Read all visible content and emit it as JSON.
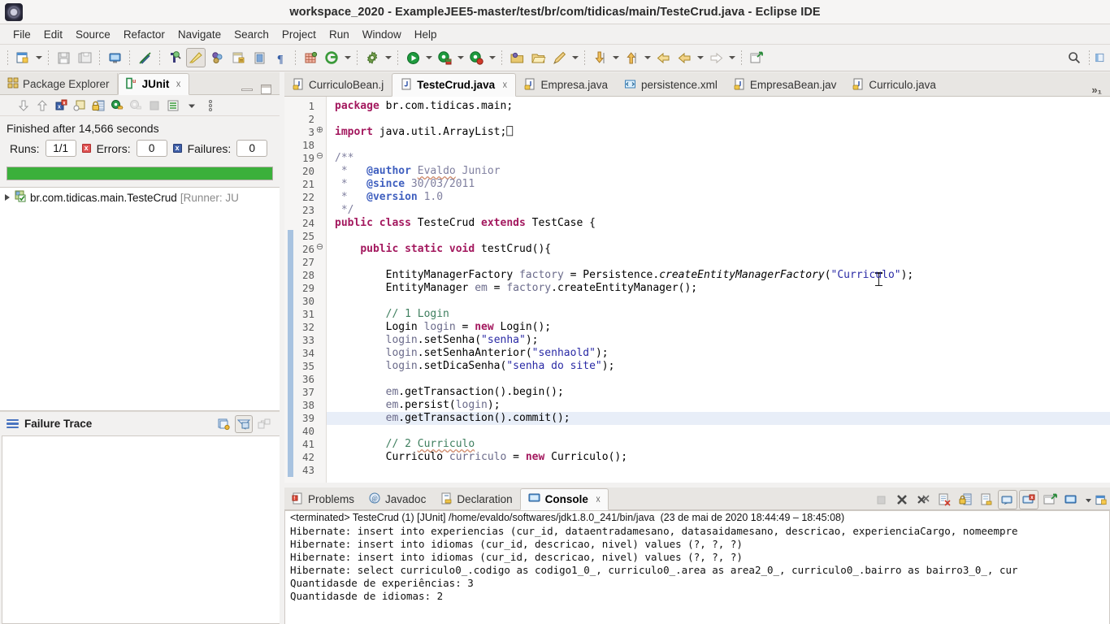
{
  "window": {
    "title": "workspace_2020 - ExampleJEE5-master/test/br/com/tidicas/main/TesteCrud.java - Eclipse IDE",
    "app_icon": "eclipse-icon"
  },
  "menubar": {
    "items": [
      "File",
      "Edit",
      "Source",
      "Refactor",
      "Navigate",
      "Search",
      "Project",
      "Run",
      "Window",
      "Help"
    ]
  },
  "toolbar": {
    "buttons": [
      {
        "name": "new-wizard",
        "icon": "new-file-icon",
        "dropdown": true
      },
      {
        "name": "save",
        "icon": "save-icon",
        "dropdown": false
      },
      {
        "name": "save-all",
        "icon": "save-all-icon",
        "dropdown": false
      },
      {
        "name": "new-java-class",
        "icon": "monitor-icon",
        "dropdown": false
      },
      {
        "name": "toggle-mark-occurrences",
        "icon": "pen-strike-icon",
        "dropdown": false
      },
      {
        "name": "open-type",
        "icon": "search-type-icon",
        "dropdown": false
      },
      {
        "name": "quick-access",
        "icon": "highlight-icon",
        "dropdown": false
      },
      {
        "name": "link-with-editor",
        "icon": "spheres-icon",
        "dropdown": false
      },
      {
        "name": "new-package",
        "icon": "package-icon",
        "dropdown": false
      },
      {
        "name": "open-task",
        "icon": "task-icon",
        "dropdown": false
      },
      {
        "name": "pilcrow",
        "icon": "pilcrow-icon",
        "dropdown": false
      },
      {
        "name": "new-deployment",
        "icon": "grid-icon",
        "dropdown": false
      },
      {
        "name": "git-repository",
        "icon": "git-icon",
        "dropdown": true
      },
      {
        "name": "external-tools",
        "icon": "gear-icon",
        "dropdown": true
      },
      {
        "name": "run",
        "icon": "run-icon",
        "dropdown": true
      },
      {
        "name": "debug",
        "icon": "debug-green-icon",
        "dropdown": true
      },
      {
        "name": "coverage",
        "icon": "coverage-red-icon",
        "dropdown": true
      },
      {
        "name": "open-resource",
        "icon": "folder-open-blue-icon",
        "dropdown": false
      },
      {
        "name": "open-folder",
        "icon": "folder-open-icon",
        "dropdown": false
      },
      {
        "name": "annotation",
        "icon": "pencil-icon",
        "dropdown": true
      },
      {
        "name": "next-annotation",
        "icon": "arrow-down-marker-icon",
        "dropdown": true
      },
      {
        "name": "previous-annotation",
        "icon": "arrow-up-marker-icon",
        "dropdown": true
      },
      {
        "name": "back",
        "icon": "back-arrow-icon",
        "dropdown": false
      },
      {
        "name": "forward-history",
        "icon": "left-arrow-icon",
        "dropdown": true
      },
      {
        "name": "forward",
        "icon": "right-arrow-icon",
        "dropdown": true
      },
      {
        "name": "open-perspective",
        "icon": "open-perspective-icon",
        "dropdown": false
      }
    ],
    "right_buttons": [
      {
        "name": "quick-access-search",
        "icon": "search-icon"
      },
      {
        "name": "perspective-switch",
        "icon": "perspective-icon"
      }
    ]
  },
  "left_panel": {
    "tabs": [
      {
        "label": "Package Explorer",
        "icon": "package-explorer-icon",
        "active": false,
        "closable": false
      },
      {
        "label": "JUnit",
        "icon": "junit-icon",
        "active": true,
        "closable": true
      }
    ],
    "view_buttons": [
      {
        "name": "minimize-view-button",
        "icon": "minimize-icon"
      },
      {
        "name": "maximize-view-button",
        "icon": "maximize-icon"
      }
    ],
    "junit_toolbar": [
      {
        "name": "next-failure-button",
        "icon": "arrow-down-icon"
      },
      {
        "name": "previous-failure-button",
        "icon": "arrow-up-icon"
      },
      {
        "name": "show-failures-only-button",
        "icon": "failures-filter-icon"
      },
      {
        "name": "show-test-hierarchy-button",
        "icon": "hierarchy-icon"
      },
      {
        "name": "lock-scroll-button",
        "icon": "lock-icon"
      },
      {
        "name": "rerun-test-button",
        "icon": "rerun-icon"
      },
      {
        "name": "rerun-failed-button",
        "icon": "rerun-failed-icon"
      },
      {
        "name": "stop-button",
        "icon": "stop-icon"
      },
      {
        "name": "test-runner-list-button",
        "icon": "list-icon"
      },
      {
        "name": "test-runner-dropdown",
        "icon": "chevron-down-icon"
      },
      {
        "name": "view-menu-button",
        "icon": "view-menu-icon"
      }
    ],
    "status_text": "Finished after 14,566 seconds",
    "counters": {
      "runs_label": "Runs:",
      "runs_value": "1/1",
      "errors_label": "Errors:",
      "errors_value": "0",
      "failures_label": "Failures:",
      "failures_value": "0"
    },
    "progress": {
      "percent": 100,
      "color": "#3bb03b"
    },
    "tree": [
      {
        "icon": "test-class-passed-icon",
        "label": "br.com.tidicas.main.TesteCrud",
        "suffix": " [Runner: JU",
        "expanded": false
      }
    ],
    "failure_trace": {
      "title": "Failure Trace",
      "icon": "hamburger-icon",
      "buttons": [
        {
          "name": "copy-trace-button",
          "icon": "copy-icon"
        },
        {
          "name": "filter-stack-trace-button",
          "icon": "filter-icon"
        },
        {
          "name": "compare-result-button",
          "icon": "compare-icon"
        }
      ],
      "content": ""
    }
  },
  "editor": {
    "tabs": [
      {
        "label": "CurriculoBean.j",
        "icon": "java-file-icon",
        "active": false,
        "closable": false
      },
      {
        "label": "TesteCrud.java",
        "icon": "java-file-icon",
        "active": true,
        "closable": true
      },
      {
        "label": "Empresa.java",
        "icon": "java-file-icon",
        "active": false,
        "closable": false
      },
      {
        "label": "persistence.xml",
        "icon": "xml-file-icon",
        "active": false,
        "closable": false
      },
      {
        "label": "EmpresaBean.jav",
        "icon": "java-file-icon",
        "active": false,
        "closable": false
      },
      {
        "label": "Curriculo.java",
        "icon": "java-file-icon",
        "active": false,
        "closable": false
      }
    ],
    "overflow_indicator": "»₁",
    "highlighted_line": 39,
    "lines": [
      {
        "num": "1",
        "fold": "",
        "tokens": [
          {
            "t": "package ",
            "c": "k"
          },
          {
            "t": "br.com.tidicas.main;",
            "c": "plain"
          }
        ]
      },
      {
        "num": "2",
        "fold": "",
        "tokens": []
      },
      {
        "num": "3",
        "fold": "+",
        "tokens": [
          {
            "t": "import ",
            "c": "k"
          },
          {
            "t": "java.util.ArrayList;",
            "c": "plain"
          },
          {
            "t": "⎕",
            "c": "fold-box"
          }
        ]
      },
      {
        "num": "18",
        "fold": "",
        "tokens": []
      },
      {
        "num": "19",
        "fold": "-",
        "tokens": [
          {
            "t": "/**",
            "c": "cm"
          }
        ]
      },
      {
        "num": "20",
        "fold": "",
        "tokens": [
          {
            "t": " * ",
            "c": "cm"
          },
          {
            "t": "  @author",
            "c": "jd"
          },
          {
            "t": " ",
            "c": "cm"
          },
          {
            "t": "Evaldo",
            "c": "cm-spell"
          },
          {
            "t": " Junior",
            "c": "cm"
          }
        ]
      },
      {
        "num": "21",
        "fold": "",
        "tokens": [
          {
            "t": " * ",
            "c": "cm"
          },
          {
            "t": "  @since",
            "c": "jd"
          },
          {
            "t": " 30/03/2011",
            "c": "cm"
          }
        ]
      },
      {
        "num": "22",
        "fold": "",
        "tokens": [
          {
            "t": " * ",
            "c": "cm"
          },
          {
            "t": "  @version",
            "c": "jd"
          },
          {
            "t": " 1.0",
            "c": "cm"
          }
        ]
      },
      {
        "num": "23",
        "fold": "",
        "tokens": [
          {
            "t": " */",
            "c": "cm"
          }
        ]
      },
      {
        "num": "24",
        "fold": "",
        "tokens": [
          {
            "t": "public class ",
            "c": "k"
          },
          {
            "t": "TesteCrud ",
            "c": "plain"
          },
          {
            "t": "extends ",
            "c": "k"
          },
          {
            "t": "TestCase {",
            "c": "plain"
          }
        ]
      },
      {
        "num": "25",
        "fold": "",
        "tokens": []
      },
      {
        "num": "26",
        "fold": "-",
        "tokens": [
          {
            "t": "    ",
            "c": "plain"
          },
          {
            "t": "public static void ",
            "c": "k"
          },
          {
            "t": "testCrud(){",
            "c": "plain"
          }
        ]
      },
      {
        "num": "27",
        "fold": "",
        "tokens": []
      },
      {
        "num": "28",
        "fold": "",
        "tokens": [
          {
            "t": "        EntityManagerFactory ",
            "c": "plain"
          },
          {
            "t": "factory",
            "c": "fld"
          },
          {
            "t": " = Persistence.",
            "c": "plain"
          },
          {
            "t": "createEntityManagerFactory",
            "c": "ml"
          },
          {
            "t": "(",
            "c": "plain"
          },
          {
            "t": "\"Curriculo\"",
            "c": "s"
          },
          {
            "t": ");",
            "c": "plain"
          }
        ]
      },
      {
        "num": "29",
        "fold": "",
        "tokens": [
          {
            "t": "        EntityManager ",
            "c": "plain"
          },
          {
            "t": "em",
            "c": "fld"
          },
          {
            "t": " = ",
            "c": "plain"
          },
          {
            "t": "factory",
            "c": "fld"
          },
          {
            "t": ".createEntityManager();",
            "c": "plain"
          }
        ]
      },
      {
        "num": "30",
        "fold": "",
        "tokens": []
      },
      {
        "num": "31",
        "fold": "",
        "tokens": [
          {
            "t": "        // 1 Login",
            "c": "c"
          }
        ]
      },
      {
        "num": "32",
        "fold": "",
        "tokens": [
          {
            "t": "        Login ",
            "c": "plain"
          },
          {
            "t": "login",
            "c": "fld"
          },
          {
            "t": " = ",
            "c": "plain"
          },
          {
            "t": "new ",
            "c": "k"
          },
          {
            "t": "Login();",
            "c": "plain"
          }
        ]
      },
      {
        "num": "33",
        "fold": "",
        "tokens": [
          {
            "t": "        ",
            "c": "plain"
          },
          {
            "t": "login",
            "c": "fld"
          },
          {
            "t": ".setSenha(",
            "c": "plain"
          },
          {
            "t": "\"senha\"",
            "c": "s"
          },
          {
            "t": ");",
            "c": "plain"
          }
        ]
      },
      {
        "num": "34",
        "fold": "",
        "tokens": [
          {
            "t": "        ",
            "c": "plain"
          },
          {
            "t": "login",
            "c": "fld"
          },
          {
            "t": ".setSenhaAnterior(",
            "c": "plain"
          },
          {
            "t": "\"senhaold\"",
            "c": "s"
          },
          {
            "t": ");",
            "c": "plain"
          }
        ]
      },
      {
        "num": "35",
        "fold": "",
        "tokens": [
          {
            "t": "        ",
            "c": "plain"
          },
          {
            "t": "login",
            "c": "fld"
          },
          {
            "t": ".setDicaSenha(",
            "c": "plain"
          },
          {
            "t": "\"senha do site\"",
            "c": "s"
          },
          {
            "t": ");",
            "c": "plain"
          }
        ]
      },
      {
        "num": "36",
        "fold": "",
        "tokens": []
      },
      {
        "num": "37",
        "fold": "",
        "tokens": [
          {
            "t": "        ",
            "c": "plain"
          },
          {
            "t": "em",
            "c": "fld"
          },
          {
            "t": ".getTransaction().begin();",
            "c": "plain"
          }
        ]
      },
      {
        "num": "38",
        "fold": "",
        "tokens": [
          {
            "t": "        ",
            "c": "plain"
          },
          {
            "t": "em",
            "c": "fld"
          },
          {
            "t": ".persist(",
            "c": "plain"
          },
          {
            "t": "login",
            "c": "fld"
          },
          {
            "t": ");",
            "c": "plain"
          }
        ]
      },
      {
        "num": "39",
        "fold": "",
        "tokens": [
          {
            "t": "        ",
            "c": "plain"
          },
          {
            "t": "em",
            "c": "fld"
          },
          {
            "t": ".getTransaction().commit();",
            "c": "plain"
          }
        ]
      },
      {
        "num": "40",
        "fold": "",
        "tokens": []
      },
      {
        "num": "41",
        "fold": "",
        "tokens": [
          {
            "t": "        // 2 ",
            "c": "c"
          },
          {
            "t": "Curriculo",
            "c": "c-spell"
          }
        ]
      },
      {
        "num": "42",
        "fold": "",
        "tokens": [
          {
            "t": "        Curriculo ",
            "c": "plain"
          },
          {
            "t": "curriculo",
            "c": "fld"
          },
          {
            "t": " = ",
            "c": "plain"
          },
          {
            "t": "new ",
            "c": "k"
          },
          {
            "t": "Curriculo();",
            "c": "plain"
          }
        ]
      },
      {
        "num": "43",
        "fold": "",
        "tokens": []
      }
    ]
  },
  "console": {
    "tabs": [
      {
        "label": "Problems",
        "icon": "problems-icon",
        "active": false,
        "closable": false
      },
      {
        "label": "Javadoc",
        "icon": "javadoc-icon",
        "active": false,
        "closable": false
      },
      {
        "label": "Declaration",
        "icon": "declaration-icon",
        "active": false,
        "closable": false
      },
      {
        "label": "Console",
        "icon": "console-icon",
        "active": true,
        "closable": true
      }
    ],
    "toolbar": [
      {
        "name": "terminate-button",
        "icon": "stop-icon",
        "framed": false
      },
      {
        "name": "remove-launch-button",
        "icon": "remove-x-icon",
        "framed": false
      },
      {
        "name": "remove-all-terminated-button",
        "icon": "remove-all-x-icon",
        "framed": false
      },
      {
        "name": "clear-console-button",
        "icon": "clear-console-icon",
        "framed": false
      },
      {
        "name": "scroll-lock-button",
        "icon": "scroll-lock-icon",
        "framed": false
      },
      {
        "name": "word-wrap-button",
        "icon": "word-wrap-icon",
        "framed": false
      },
      {
        "name": "show-console-on-output-button",
        "icon": "show-console-icon",
        "framed": true
      },
      {
        "name": "show-console-on-error-button",
        "icon": "show-console-error-icon",
        "framed": true
      },
      {
        "name": "pin-console-button",
        "icon": "pin-console-icon",
        "framed": false
      },
      {
        "name": "display-selected-console-button",
        "icon": "display-console-icon",
        "framed": false
      },
      {
        "name": "display-console-dropdown",
        "icon": "chevron-down-icon",
        "framed": false
      },
      {
        "name": "open-console-button",
        "icon": "open-console-icon",
        "framed": false
      }
    ],
    "header": "<terminated> TesteCrud (1) [JUnit] /home/evaldo/softwares/jdk1.8.0_241/bin/java  (23 de mai de 2020 18:44:49 – 18:45:08)",
    "lines": [
      "Hibernate: insert into experiencias (cur_id, dataentradamesano, datasaidamesano, descricao, experienciaCargo, nomeempre",
      "Hibernate: insert into idiomas (cur_id, descricao, nivel) values (?, ?, ?)",
      "Hibernate: insert into idiomas (cur_id, descricao, nivel) values (?, ?, ?)",
      "Hibernate: select curriculo0_.codigo as codigo1_0_, curriculo0_.area as area2_0_, curriculo0_.bairro as bairro3_0_, cur",
      "Quantidasde de experiências: 3",
      "Quantidasde de idiomas: 2"
    ]
  }
}
